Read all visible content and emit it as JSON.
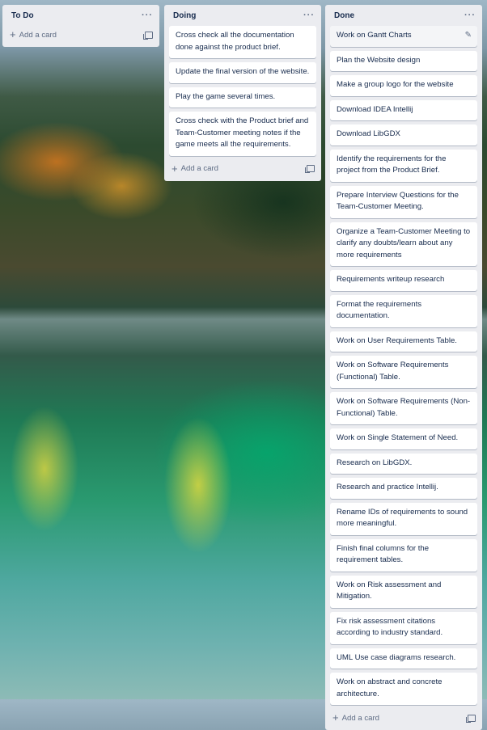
{
  "lists": [
    {
      "title": "To Do",
      "menu": "···",
      "cards": [],
      "add_label": "Add a card"
    },
    {
      "title": "Doing",
      "menu": "···",
      "cards": [
        "Cross check all the documentation done against the product brief.",
        "Update the final version of the website.",
        "Play the game several times.",
        "Cross check with the Product brief and Team-Customer meeting notes if the game meets all the requirements."
      ],
      "add_label": "Add a card"
    },
    {
      "title": "Done",
      "menu": "···",
      "cards": [
        "Work on Gantt Charts",
        "Plan the Website design",
        "Make a group logo for the website",
        "Download IDEA Intellij",
        "Download LibGDX",
        "Identify the requirements for the project from the Product Brief.",
        "Prepare Interview Questions for the Team-Customer Meeting.",
        "Organize a Team-Customer Meeting to clarify any doubts/learn about any more requirements",
        "Requirements writeup research",
        "Format the requirements documentation.",
        "Work on User Requirements Table.",
        "Work on Software Requirements (Functional) Table.",
        "Work on Software Requirements (Non-Functional) Table.",
        "Work on Single Statement of Need.",
        "Research on LibGDX.",
        "Research and practice Intellij.",
        "Rename IDs of requirements to sound more meaningful.",
        "Finish final columns for the requirement tables.",
        "Work on Risk assessment and Mitigation.",
        "Fix risk assessment citations according to industry standard.",
        "UML Use case diagrams research.",
        "Work on abstract and concrete architecture."
      ],
      "add_label": "Add a card"
    }
  ]
}
